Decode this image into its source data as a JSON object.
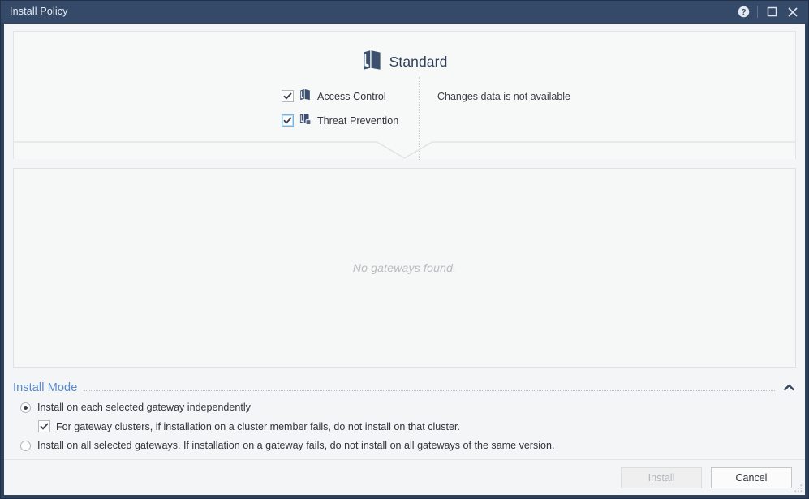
{
  "window": {
    "title": "Install Policy",
    "controls": [
      {
        "name": "help-icon",
        "label": "?"
      },
      {
        "name": "maximize-icon",
        "label": "Maximize"
      },
      {
        "name": "close-icon",
        "label": "Close"
      }
    ]
  },
  "policy": {
    "package_name": "Standard",
    "package_icon": "policy-package-icon",
    "layers": [
      {
        "label": "Access Control",
        "checked": true,
        "focused": false,
        "icon": "access-control-icon"
      },
      {
        "label": "Threat Prevention",
        "checked": true,
        "focused": true,
        "icon": "threat-prevention-icon"
      }
    ],
    "changes_note": "Changes data is not available"
  },
  "gateways": {
    "empty_message": "No gateways found."
  },
  "install_mode": {
    "title": "Install Mode",
    "collapse_icon": "chevron-up-icon",
    "options": [
      {
        "type": "radio",
        "selected": true,
        "label": "Install on each selected gateway independently"
      },
      {
        "type": "checkbox",
        "checked": true,
        "label": "For gateway clusters, if installation on a cluster member fails, do not install on that cluster."
      },
      {
        "type": "radio",
        "selected": false,
        "label": "Install on all selected gateways. If installation on a gateway fails, do not install on all gateways of the same version."
      }
    ]
  },
  "footer": {
    "install_label": "Install",
    "install_disabled": true,
    "cancel_label": "Cancel"
  },
  "colors": {
    "titlebar": "#354a68",
    "window_border": "#2e4059",
    "accent_blue": "#5b8ac9",
    "panel_bg": "#f7f8f8",
    "client_bg": "#f4f5f6"
  }
}
